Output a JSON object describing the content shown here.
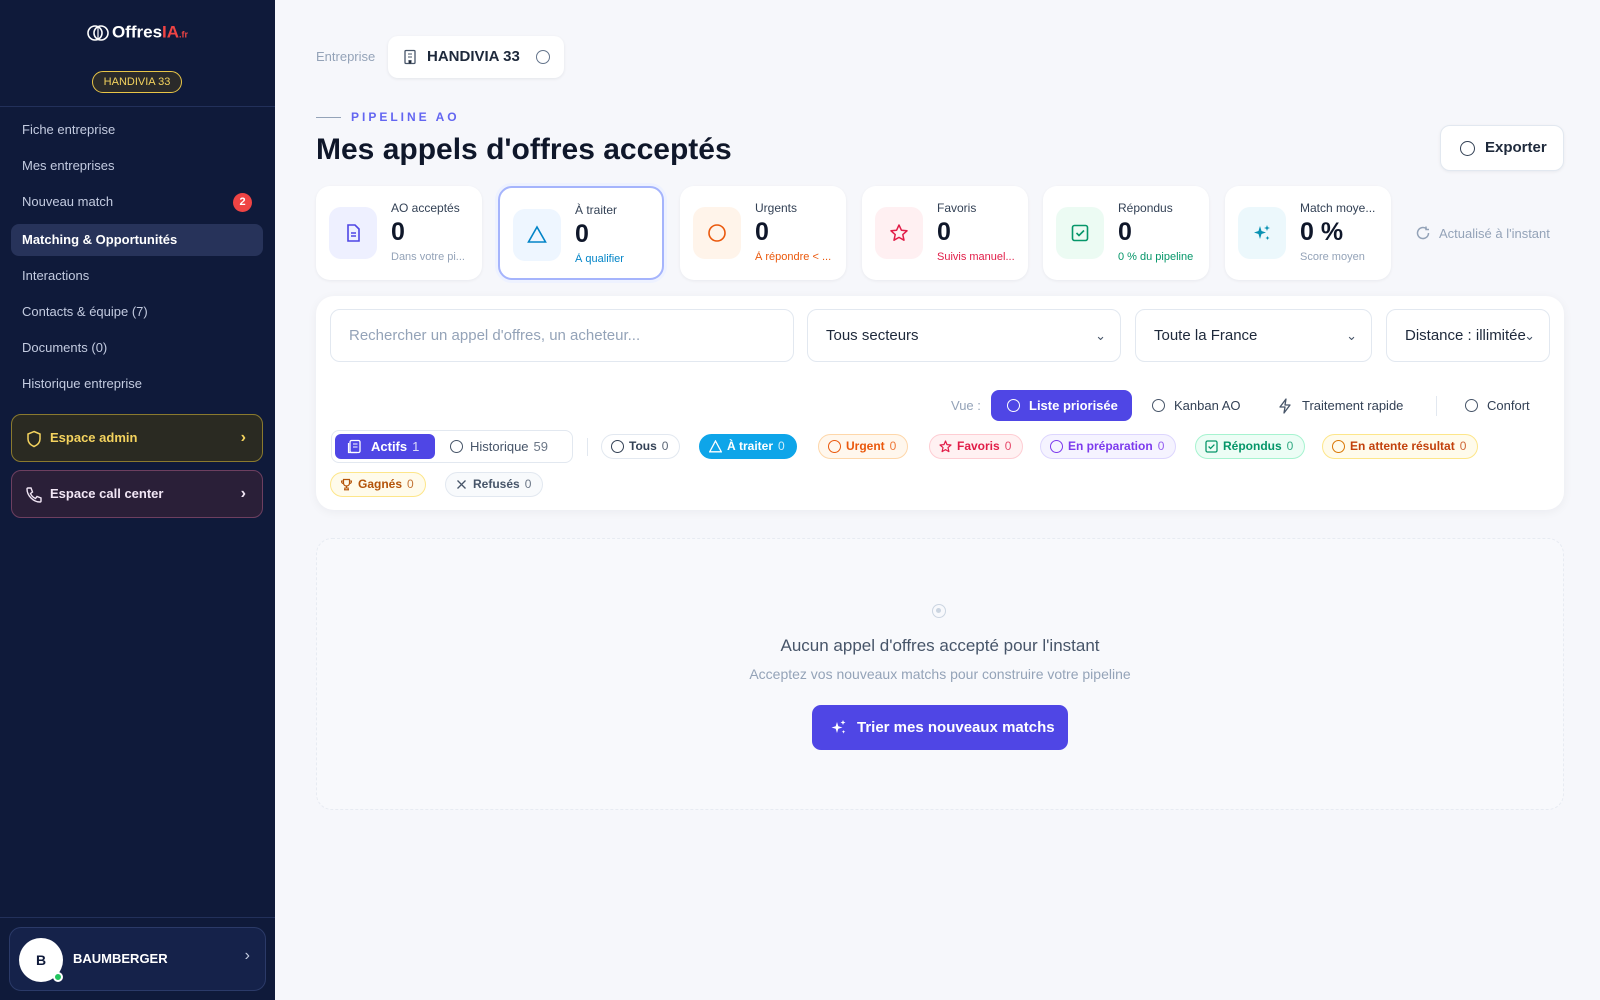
{
  "sidebar": {
    "logo": {
      "main": "Offres",
      "accent": "IA",
      "suffix": ".fr"
    },
    "company_pill": "HANDIVIA 33",
    "nav": [
      {
        "label": "Fiche entreprise"
      },
      {
        "label": "Mes entreprises"
      },
      {
        "label": "Nouveau match",
        "badge": "2"
      },
      {
        "label": "Matching & Opportunités",
        "active": true
      },
      {
        "label": "Interactions"
      },
      {
        "label": "Contacts & équipe (7)"
      },
      {
        "label": "Documents (0)"
      },
      {
        "label": "Historique entreprise"
      }
    ],
    "admin_space": "Espace admin",
    "callcenter_space": "Espace call center",
    "user": {
      "initial": "B",
      "name": "BAUMBERGER"
    }
  },
  "header": {
    "entreprise_label": "Entreprise",
    "entreprise_name": "HANDIVIA 33",
    "eyebrow": "PIPELINE AO",
    "title": "Mes appels d'offres acceptés",
    "export_label": "Exporter"
  },
  "stats": [
    {
      "label": "AO acceptés",
      "value": "0",
      "sub": "Dans votre pi...",
      "icon": "document-icon",
      "color": "#4f46e5"
    },
    {
      "label": "À traiter",
      "value": "0",
      "sub": "À qualifier",
      "icon": "triangle-icon",
      "color": "#0284c7"
    },
    {
      "label": "Urgents",
      "value": "0",
      "sub": "À répondre < ...",
      "icon": "circle-icon",
      "color": "#ea580c"
    },
    {
      "label": "Favoris",
      "value": "0",
      "sub": "Suivis manuel...",
      "icon": "star-icon",
      "color": "#e11d48"
    },
    {
      "label": "Répondus",
      "value": "0",
      "sub": "0 % du pipeline",
      "icon": "check-square-icon",
      "color": "#059669"
    },
    {
      "label": "Match moye...",
      "value": "0 %",
      "sub": "Score moyen",
      "icon": "sparkles-icon",
      "color": "#0891b2"
    }
  ],
  "refresh_label": "Actualisé à l'instant",
  "filters": {
    "search_placeholder": "Rechercher un appel d'offres, un acheteur...",
    "sector": "Tous secteurs",
    "region": "Toute la France",
    "distance": "Distance : illimitée"
  },
  "view": {
    "label": "Vue :",
    "options": [
      "Liste priorisée",
      "Kanban AO",
      "Traitement rapide",
      "Confort"
    ]
  },
  "segments": [
    {
      "label": "Actifs",
      "count": "1"
    },
    {
      "label": "Historique",
      "count": "59"
    }
  ],
  "status_chips": [
    {
      "label": "Tous",
      "count": "0"
    },
    {
      "label": "À traiter",
      "count": "0"
    },
    {
      "label": "Urgent",
      "count": "0"
    },
    {
      "label": "Favoris",
      "count": "0"
    },
    {
      "label": "En préparation",
      "count": "0"
    },
    {
      "label": "Répondus",
      "count": "0"
    },
    {
      "label": "En attente résultat",
      "count": "0"
    },
    {
      "label": "Gagnés",
      "count": "0"
    },
    {
      "label": "Refusés",
      "count": "0"
    }
  ],
  "empty": {
    "title": "Aucun appel d'offres accepté pour l'instant",
    "subtitle": "Acceptez vos nouveaux matchs pour construire votre pipeline",
    "cta": "Trier mes nouveaux matchs"
  }
}
